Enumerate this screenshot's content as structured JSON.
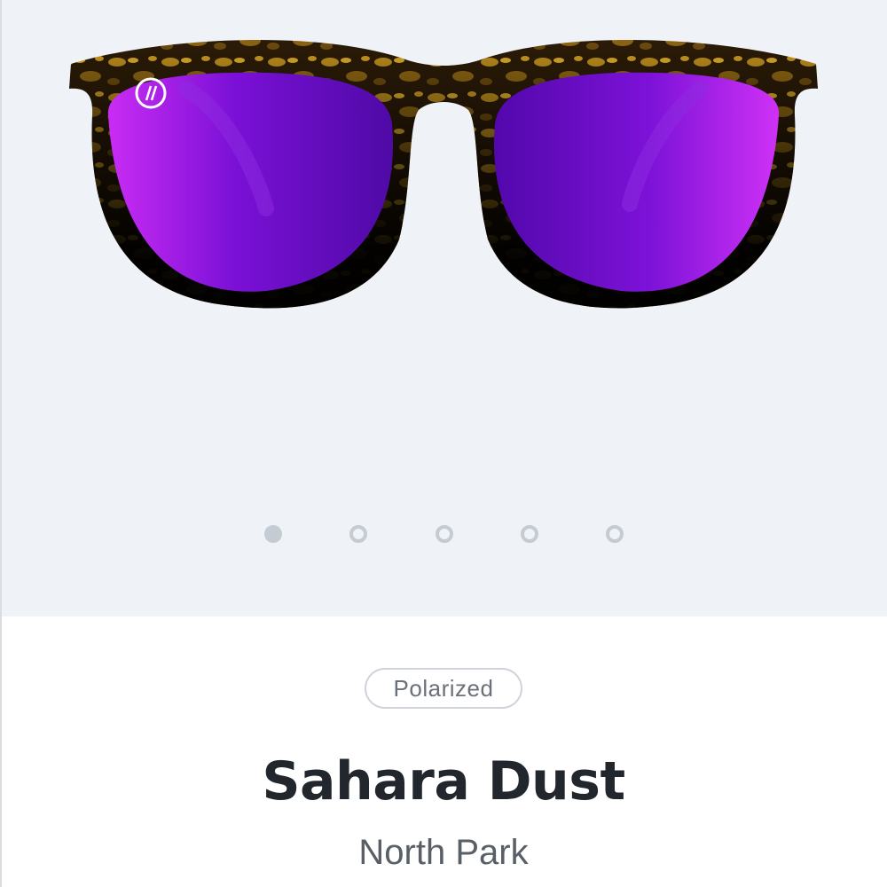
{
  "product": {
    "image_alt": "Sahara Dust sunglasses",
    "badge": "Polarized",
    "name": "Sahara Dust",
    "collection": "North Park",
    "colors": {
      "lens": "#7a0fd8",
      "frame": "#1a120a",
      "tortoise": "#b8860b",
      "gallery_bg": "#eff2f6"
    }
  },
  "carousel": {
    "total": 5,
    "active_index": 1
  }
}
